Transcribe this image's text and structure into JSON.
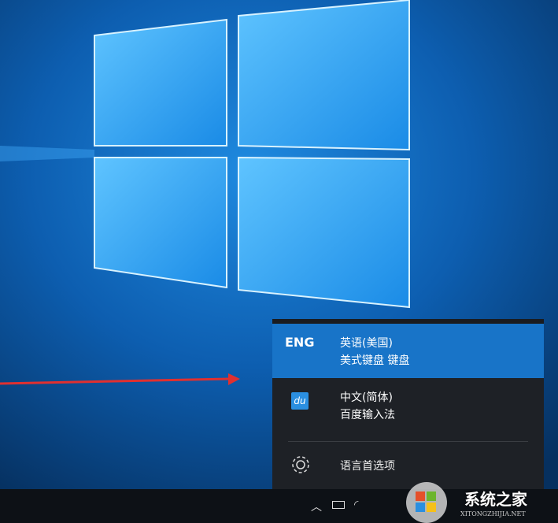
{
  "language_menu": {
    "items": [
      {
        "badge": "ENG",
        "language": "英语(美国)",
        "keyboard": "美式键盘 键盘",
        "selected": true
      },
      {
        "badge": "du",
        "language": "中文(简体)",
        "keyboard": "百度输入法",
        "selected": false
      }
    ],
    "preferences_label": "语言首选项"
  },
  "taskbar": {
    "tray_icons": [
      "chevron-up-icon",
      "battery-icon",
      "wifi-icon"
    ]
  },
  "watermark": {
    "title": "系统之家",
    "subtitle": "XITONGZHIJIA.NET"
  },
  "colors": {
    "accent": "#1874c8",
    "menu_bg": "#1e2126",
    "annotation_arrow": "#e03030"
  }
}
